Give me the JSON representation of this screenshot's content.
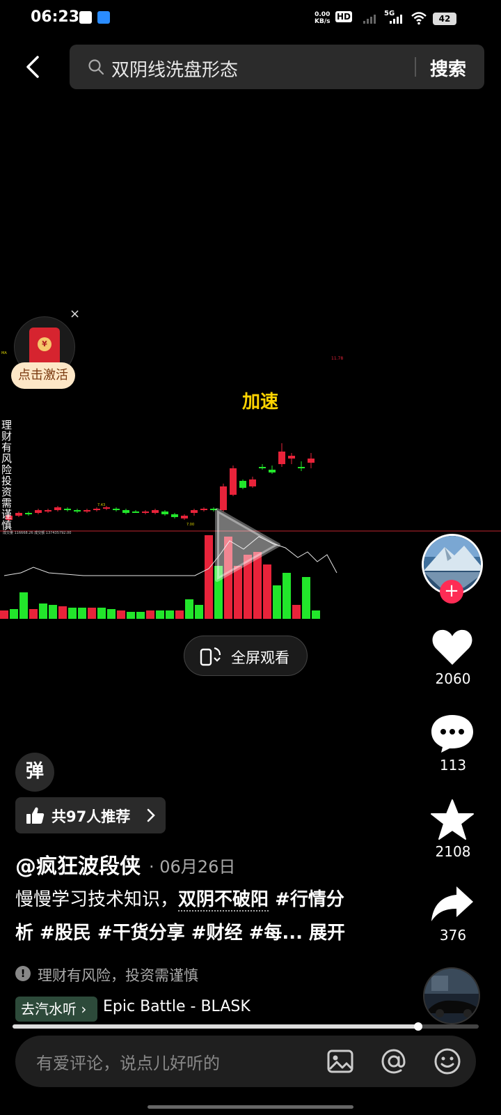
{
  "status_bar": {
    "time": "06:23",
    "net_speed_value": "0.00",
    "net_speed_unit": "KB/s",
    "hd_label": "HD",
    "network": "5G",
    "battery": "42"
  },
  "search": {
    "query": "双阴线洗盘形态",
    "button_label": "搜索"
  },
  "red_packet": {
    "label": "点击激活",
    "close": "×",
    "coin": "¥"
  },
  "video": {
    "overlay_label": "加速",
    "risk_vertical": "理财有风险 投资需谨慎",
    "fullscreen_label": "全屏观看"
  },
  "chart_data": {
    "type": "candlestick",
    "title": "",
    "series": [],
    "volume_visible": true
  },
  "actions": {
    "like_count": "2060",
    "comment_count": "113",
    "favorite_count": "2108",
    "share_count": "376",
    "follow_symbol": "+"
  },
  "danmaku_label": "弹",
  "recommend": {
    "label": "共97人推荐"
  },
  "post": {
    "author": "@疯狂波段侠",
    "date": "· 06月26日",
    "caption_line1_text": "慢慢学习技术知识，",
    "caption_line1_link": "双阴不破阳",
    "caption_line1_tag": " #行情分",
    "caption_line2_tags": "析 #股民 #干货分享 #财经 #每...",
    "caption_expand": " 展开"
  },
  "warning": {
    "icon": "!",
    "text": "理财有风险，投资需谨慎"
  },
  "music": {
    "pill_label": "去汽水听 ›",
    "title": "Epic Battle - BLASK"
  },
  "progress": {
    "fraction": 0.87
  },
  "comment": {
    "placeholder": "有爱评论，说点儿好听的"
  },
  "colors": {
    "accent_red": "#fe2c55",
    "candle_up": "#e8233a",
    "candle_down": "#22e62b",
    "overlay_yellow": "#ffd400"
  }
}
